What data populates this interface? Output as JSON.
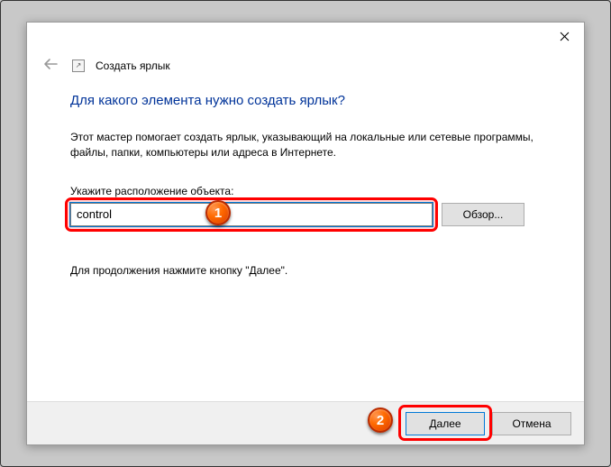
{
  "window": {
    "title": "Создать ярлык"
  },
  "page": {
    "heading": "Для какого элемента нужно создать ярлык?",
    "description": "Этот мастер помогает создать ярлык, указывающий на локальные или сетевые программы, файлы, папки, компьютеры или адреса в Интернете.",
    "location_label": "Укажите расположение объекта:",
    "location_value": "control",
    "browse_label": "Обзор...",
    "continue_hint": "Для продолжения нажмите кнопку \"Далее\"."
  },
  "footer": {
    "next_label": "Далее",
    "cancel_label": "Отмена"
  },
  "annotations": {
    "marker1": "1",
    "marker2": "2"
  }
}
